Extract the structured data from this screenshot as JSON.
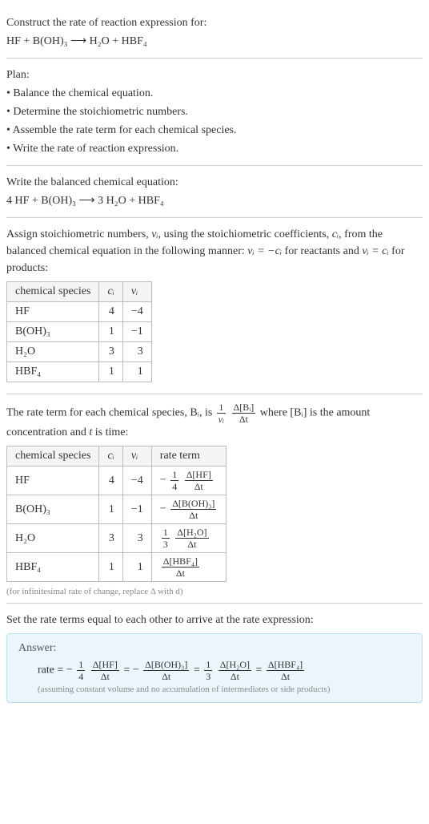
{
  "intro": {
    "title": "Construct the rate of reaction expression for:",
    "equation": "HF + B(OH)₃  ⟶  H₂O + HBF₄"
  },
  "plan": {
    "heading": "Plan:",
    "items": [
      "• Balance the chemical equation.",
      "• Determine the stoichiometric numbers.",
      "• Assemble the rate term for each chemical species.",
      "• Write the rate of reaction expression."
    ]
  },
  "balanced": {
    "heading": "Write the balanced chemical equation:",
    "equation": "4 HF + B(OH)₃  ⟶  3 H₂O + HBF₄"
  },
  "stoich": {
    "text_parts": {
      "p1": "Assign stoichiometric numbers, ",
      "nu_i": "νᵢ",
      "p2": ", using the stoichiometric coefficients, ",
      "c_i": "cᵢ",
      "p3": ", from the balanced chemical equation in the following manner: ",
      "rel1": "νᵢ = −cᵢ",
      "p4": " for reactants and ",
      "rel2": "νᵢ = cᵢ",
      "p5": " for products:"
    },
    "headers": [
      "chemical species",
      "cᵢ",
      "νᵢ"
    ],
    "rows": [
      {
        "species": "HF",
        "c": "4",
        "nu": "−4"
      },
      {
        "species": "B(OH)₃",
        "c": "1",
        "nu": "−1"
      },
      {
        "species": "H₂O",
        "c": "3",
        "nu": "3"
      },
      {
        "species": "HBF₄",
        "c": "1",
        "nu": "1"
      }
    ]
  },
  "rateterm": {
    "lead1": "The rate term for each chemical species, Bᵢ, is ",
    "frac1_num": "1",
    "frac1_den": "νᵢ",
    "frac2_num": "Δ[Bᵢ]",
    "frac2_den": "Δt",
    "lead2": " where [Bᵢ] is the amount concentration and ",
    "t": "t",
    "lead3": " is time:",
    "headers": [
      "chemical species",
      "cᵢ",
      "νᵢ",
      "rate term"
    ],
    "rows": [
      {
        "species": "HF",
        "c": "4",
        "nu": "−4",
        "term_prefix": "− ",
        "coef_num": "1",
        "coef_den": "4",
        "dnum": "Δ[HF]",
        "dden": "Δt"
      },
      {
        "species": "B(OH)₃",
        "c": "1",
        "nu": "−1",
        "term_prefix": "− ",
        "coef_num": "",
        "coef_den": "",
        "dnum": "Δ[B(OH)₃]",
        "dden": "Δt"
      },
      {
        "species": "H₂O",
        "c": "3",
        "nu": "3",
        "term_prefix": "",
        "coef_num": "1",
        "coef_den": "3",
        "dnum": "Δ[H₂O]",
        "dden": "Δt"
      },
      {
        "species": "HBF₄",
        "c": "1",
        "nu": "1",
        "term_prefix": "",
        "coef_num": "",
        "coef_den": "",
        "dnum": "Δ[HBF₄]",
        "dden": "Δt"
      }
    ],
    "footnote": "(for infinitesimal rate of change, replace Δ with d)"
  },
  "final": {
    "heading": "Set the rate terms equal to each other to arrive at the rate expression:",
    "answer_label": "Answer:",
    "rate_lead": "rate = − ",
    "t1_coef_num": "1",
    "t1_coef_den": "4",
    "t1_num": "Δ[HF]",
    "t1_den": "Δt",
    "eq1": " = − ",
    "t2_num": "Δ[B(OH)₃]",
    "t2_den": "Δt",
    "eq2": " = ",
    "t3_coef_num": "1",
    "t3_coef_den": "3",
    "t3_num": "Δ[H₂O]",
    "t3_den": "Δt",
    "eq3": " = ",
    "t4_num": "Δ[HBF₄]",
    "t4_den": "Δt",
    "note": "(assuming constant volume and no accumulation of intermediates or side products)"
  }
}
